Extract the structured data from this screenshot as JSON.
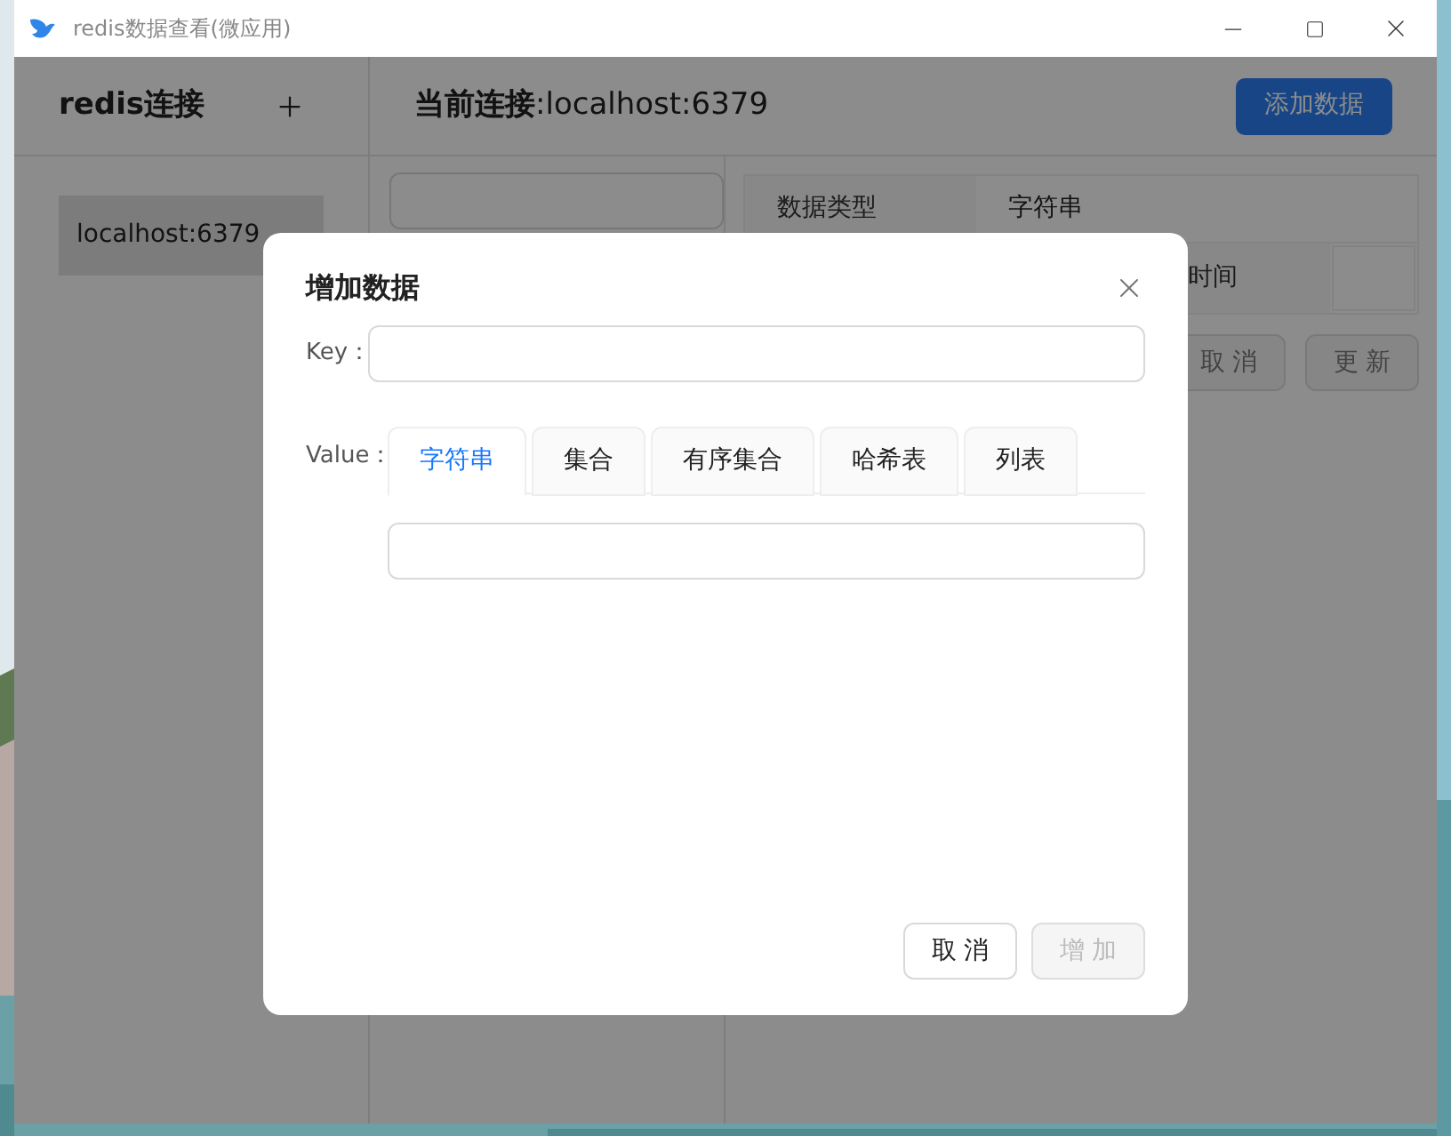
{
  "window": {
    "title": "redis数据查看(微应用)"
  },
  "sidebar": {
    "title": "redis连接",
    "connections": [
      {
        "label": "localhost:6379",
        "selected": true
      }
    ]
  },
  "header": {
    "title": "**当前连接**:localhost:6379",
    "add_button": "添加数据"
  },
  "detail": {
    "rows": [
      {
        "label": "数据类型",
        "value": "字符串",
        "kind": "text"
      },
      {
        "label": "时间",
        "kind": "input"
      }
    ],
    "buttons": [
      {
        "label": "取 消",
        "disabled": true
      },
      {
        "label": "更 新",
        "disabled": true
      }
    ]
  },
  "dialog": {
    "title": "增加数据",
    "key_label": "Key：",
    "value_label": "Value：",
    "tabs": [
      {
        "label": "字符串",
        "selected": true
      },
      {
        "label": "集合",
        "selected": false
      },
      {
        "label": "有序集合",
        "selected": false
      },
      {
        "label": "哈希表",
        "selected": false
      },
      {
        "label": "列表",
        "selected": false
      }
    ],
    "buttons": [
      {
        "label": "取 消",
        "disabled": false
      },
      {
        "label": "增 加",
        "disabled": true
      }
    ]
  }
}
